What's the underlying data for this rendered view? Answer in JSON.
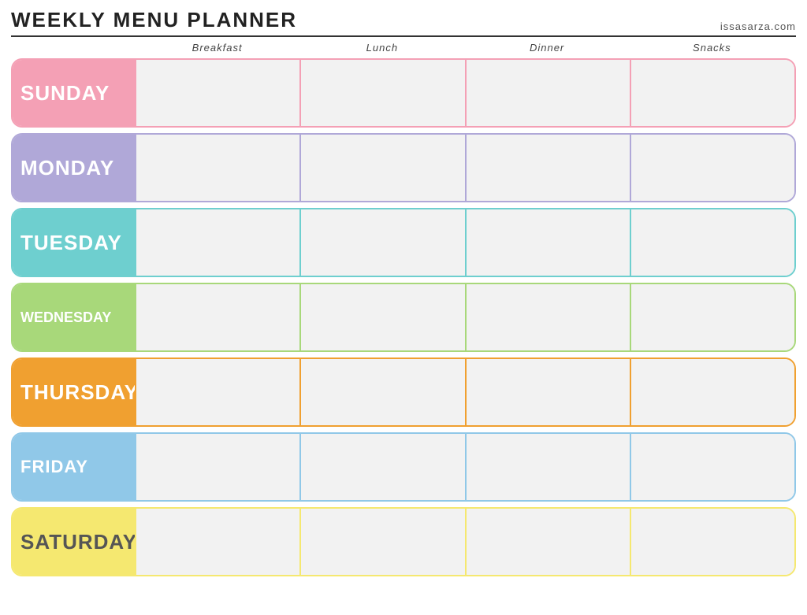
{
  "header": {
    "title": "Weekly Menu Planner",
    "website": "issasarza.com"
  },
  "columns": {
    "spacer": "",
    "breakfast": "Breakfast",
    "lunch": "Lunch",
    "dinner": "Dinner",
    "snacks": "Snacks"
  },
  "days": [
    {
      "id": "sunday",
      "label": "Sunday",
      "class": "sunday"
    },
    {
      "id": "monday",
      "label": "Monday",
      "class": "monday"
    },
    {
      "id": "tuesday",
      "label": "Tuesday",
      "class": "tuesday"
    },
    {
      "id": "wednesday",
      "label": "Wednesday",
      "class": "wednesday"
    },
    {
      "id": "thursday",
      "label": "Thursday",
      "class": "thursday"
    },
    {
      "id": "friday",
      "label": "Friday",
      "class": "friday"
    },
    {
      "id": "saturday",
      "label": "Saturday",
      "class": "saturday"
    }
  ]
}
